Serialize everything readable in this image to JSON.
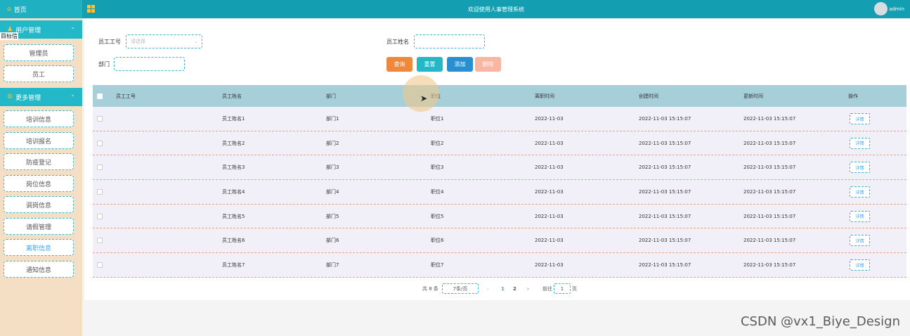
{
  "topbar": {
    "title": "欢迎使用人事管理系统",
    "user": "admin"
  },
  "sidebar": {
    "home": "首页",
    "cut_label": "目标信",
    "groups": [
      {
        "label": "用户管理",
        "items": [
          "管理员",
          "员工"
        ]
      },
      {
        "label": "更多管理",
        "items": [
          "培训信息",
          "培训报名",
          "防疫登记",
          "岗位信息",
          "调岗信息",
          "请假管理",
          "离职信息",
          "通知信息"
        ]
      }
    ],
    "active_item": "离职信息"
  },
  "search": {
    "emp_no_label": "员工工号",
    "emp_no_placeholder": "请选择",
    "emp_name_label": "员工姓名",
    "dept_label": "部门",
    "buttons": {
      "query": "查询",
      "reset": "重置",
      "add": "添加",
      "delete": "删除"
    }
  },
  "colors": {
    "query": "#f0883c",
    "reset": "#23b8c8",
    "add": "#2a8fd0",
    "delete": "#f9b6a3"
  },
  "table": {
    "headers": [
      "员工工号",
      "员工姓名",
      "部门",
      "职位",
      "离职时间",
      "创建时间",
      "更新时间",
      "操作"
    ],
    "rows": [
      [
        "",
        "员工姓名1",
        "部门1",
        "职位1",
        "2022-11-03",
        "2022-11-03 15:15:07",
        "2022-11-03 15:15:07",
        "详情"
      ],
      [
        "",
        "员工姓名2",
        "部门2",
        "职位2",
        "2022-11-03",
        "2022-11-03 15:15:07",
        "2022-11-03 15:15:07",
        "详情"
      ],
      [
        "",
        "员工姓名3",
        "部门3",
        "职位3",
        "2022-11-03",
        "2022-11-03 15:15:07",
        "2022-11-03 15:15:07",
        "详情"
      ],
      [
        "",
        "员工姓名4",
        "部门4",
        "职位4",
        "2022-11-03",
        "2022-11-03 15:15:07",
        "2022-11-03 15:15:07",
        "详情"
      ],
      [
        "",
        "员工姓名5",
        "部门5",
        "职位5",
        "2022-11-03",
        "2022-11-03 15:15:07",
        "2022-11-03 15:15:07",
        "详情"
      ],
      [
        "",
        "员工姓名6",
        "部门6",
        "职位6",
        "2022-11-03",
        "2022-11-03 15:15:07",
        "2022-11-03 15:15:07",
        "详情"
      ],
      [
        "",
        "员工姓名7",
        "部门7",
        "职位7",
        "2022-11-03",
        "2022-11-03 15:15:07",
        "2022-11-03 15:15:07",
        "详情"
      ]
    ]
  },
  "pager": {
    "total": "共 8 条",
    "page_size": "7条/页",
    "prev": "‹",
    "pages": [
      "1",
      "2"
    ],
    "next": "›",
    "goto_label": "前往",
    "goto_value": "1",
    "page_suffix": "页"
  },
  "watermark": "CSDN @vx1_Biye_Design"
}
